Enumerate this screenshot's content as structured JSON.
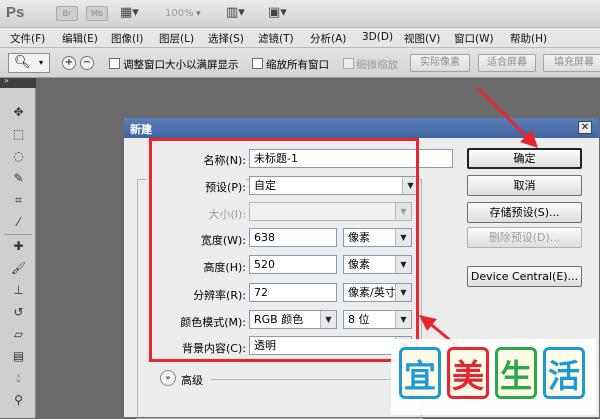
{
  "app": {
    "logo": "Ps",
    "icons": [
      {
        "name": "bridge-icon",
        "text": "Br"
      },
      {
        "name": "minibridge-icon",
        "text": "Mb"
      }
    ],
    "zoom": "100%"
  },
  "menubar": {
    "items": [
      "文件(F)",
      "编辑(E)",
      "图像(I)",
      "图层(L)",
      "选择(S)",
      "滤镜(T)",
      "分析(A)",
      "3D(D)",
      "视图(V)",
      "窗口(W)",
      "帮助(H)"
    ]
  },
  "options": {
    "resize_windows": "调整窗口大小以满屏显示",
    "zoom_all": "缩放所有窗口",
    "scrubby_zoom": "细微缩放",
    "actual_pixels": "实际像素",
    "fit_screen": "适合屏幕",
    "fill_screen": "填充屏幕"
  },
  "dialog": {
    "title": "新建",
    "close": "✕",
    "name_label": "名称(N):",
    "name_value": "未标题-1",
    "preset_label": "预设(P):",
    "preset_value": "自定",
    "size_label": "大小(I):",
    "width_label": "宽度(W):",
    "width_value": "638",
    "width_unit": "像素",
    "height_label": "高度(H):",
    "height_value": "520",
    "height_unit": "像素",
    "resolution_label": "分辨率(R):",
    "resolution_value": "72",
    "resolution_unit": "像素/英寸",
    "color_mode_label": "颜色模式(M):",
    "color_mode_value": "RGB 颜色",
    "bit_depth": "8 位",
    "background_label": "背景内容(C):",
    "background_value": "透明",
    "advanced_label": "高级",
    "buttons": {
      "ok": "确定",
      "cancel": "取消",
      "save_preset": "存储预设(S)...",
      "delete_preset": "删除预设(D)...",
      "device_central": "Device Central(E)..."
    }
  },
  "watermark": {
    "chars": [
      "宜",
      "美",
      "生",
      "活"
    ],
    "colors": [
      "#1a9ad6",
      "#e8262f",
      "#2aa84a",
      "#1a9ad6"
    ]
  },
  "colors": {
    "highlight_red": "#e8262f"
  }
}
